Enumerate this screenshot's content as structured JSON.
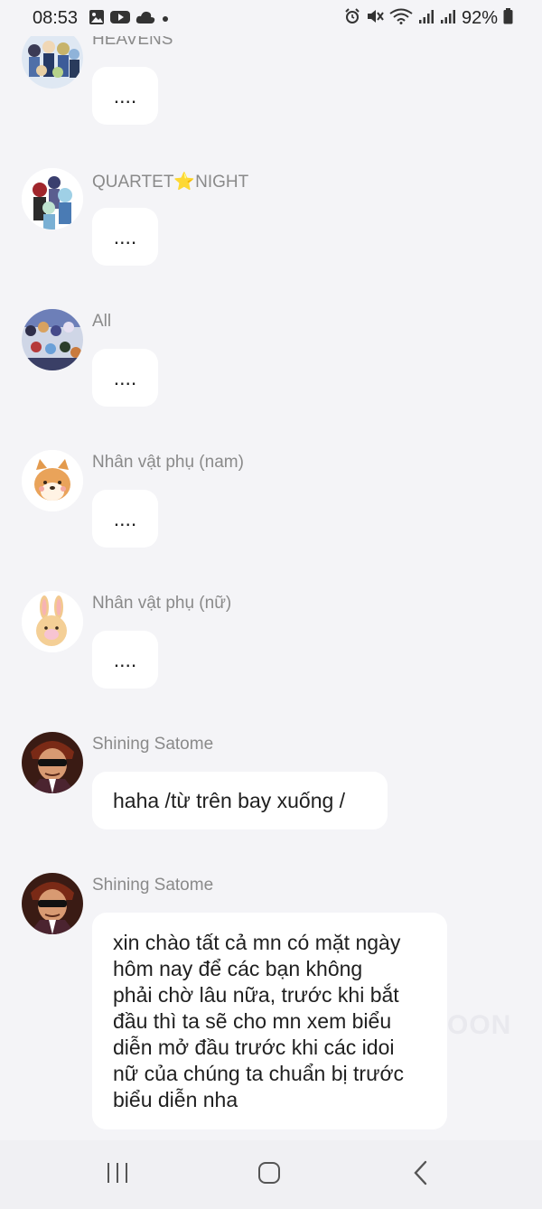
{
  "status_bar": {
    "time": "08:53",
    "battery": "92%",
    "left_icons": [
      "gallery-icon",
      "youtube-icon",
      "cloud-icon",
      "dot-icon"
    ],
    "right_icons": [
      "alarm-icon",
      "mute-icon",
      "wifi-icon",
      "signal-icon",
      "signal-icon",
      "battery-icon"
    ]
  },
  "messages": [
    {
      "sender": "HEAVENS",
      "text": "....",
      "avatar": "group-avatar-heavens"
    },
    {
      "sender": "QUARTET⭐NIGHT",
      "text": "....",
      "avatar": "group-avatar-quartet-night"
    },
    {
      "sender": "All",
      "text": "....",
      "avatar": "group-avatar-all"
    },
    {
      "sender": "Nhân vật phụ (nam)",
      "text": "....",
      "avatar": "shiba-dog-avatar"
    },
    {
      "sender": "Nhân vật phụ (nữ)",
      "text": "....",
      "avatar": "bunny-avatar"
    },
    {
      "sender": "Shining Satome",
      "text": "haha /từ trên bay xuống /",
      "avatar": "sunglasses-man-avatar"
    },
    {
      "sender": "Shining Satome",
      "avatar": "sunglasses-man-avatar",
      "lines": [
        "xin chào tất cả mn có mặt ngày",
        "hôm nay để các bạn không",
        "phải chờ lâu nữa, trước khi bắt",
        "đầu thì ta sẽ cho mn xem biểu",
        "diễn mở đầu trước khi các idoi",
        "nữ của chúng ta chuẩn bị trước",
        "biểu diễn nha"
      ]
    }
  ],
  "watermark": "OON",
  "nav": {
    "recents": "recents-icon",
    "home": "home-icon",
    "back": "back-icon"
  },
  "colors": {
    "background": "#f4f4f7",
    "bubble": "#ffffff",
    "sender": "#8a8a8a",
    "text": "#1f1f1f"
  }
}
